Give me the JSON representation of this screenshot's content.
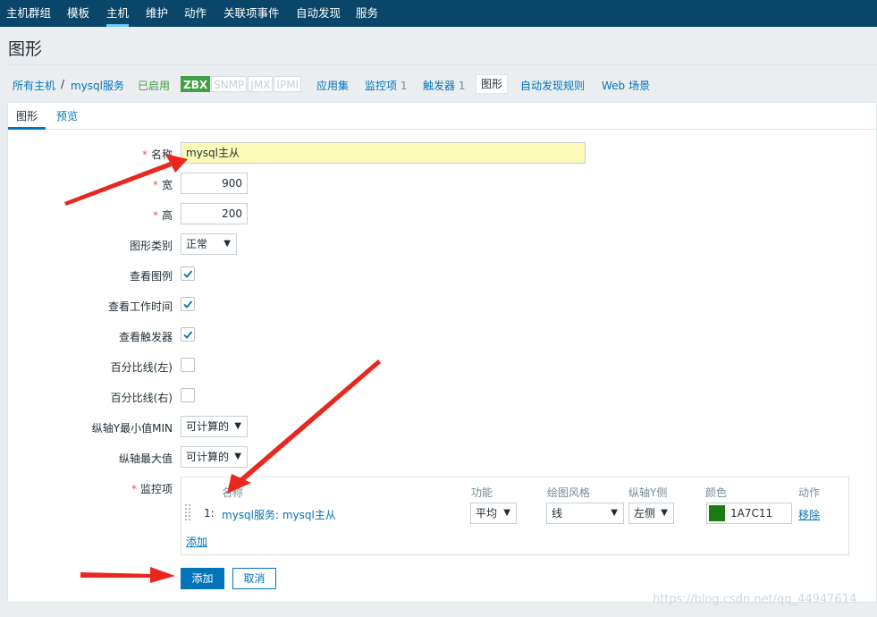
{
  "topnav": {
    "items": [
      "主机群组",
      "模板",
      "主机",
      "维护",
      "动作",
      "关联项事件",
      "自动发现",
      "服务"
    ],
    "active": "主机"
  },
  "page": {
    "title": "图形"
  },
  "hostnav": {
    "all_hosts": "所有主机",
    "separator": "/",
    "host": "mysql服务",
    "status": "已启用",
    "badges": [
      "ZBX",
      "SNMP",
      "JMX",
      "IPMI"
    ],
    "applications": "应用集",
    "items_label": "监控项",
    "items_count": "1",
    "triggers_label": "触发器",
    "triggers_count": "1",
    "graphs": "图形",
    "discovery": "自动发现规则",
    "web": "Web 场景"
  },
  "tabs": {
    "graph": "图形",
    "preview": "预览"
  },
  "form": {
    "name_label": "名称",
    "name_value": "mysql主从",
    "width_label": "宽",
    "width_value": "900",
    "height_label": "高",
    "height_value": "200",
    "graph_type_label": "图形类别",
    "graph_type_value": "正常",
    "show_legend_label": "查看图例",
    "show_working_time_label": "查看工作时间",
    "show_triggers_label": "查看触发器",
    "percentile_left_label": "百分比线(左)",
    "percentile_right_label": "百分比线(右)",
    "y_min_label": "纵轴Y最小值MIN",
    "y_min_value": "可计算的",
    "y_max_label": "纵轴最大值",
    "y_max_value": "可计算的",
    "items_label": "监控项"
  },
  "items_table": {
    "headers": {
      "name": "名称",
      "function": "功能",
      "style": "绘图风格",
      "y_side": "纵轴Y侧",
      "color": "颜色",
      "action": "动作"
    },
    "rows": [
      {
        "index": "1:",
        "name": "mysql服务: mysql主从",
        "function": "平均",
        "style": "线",
        "y_side": "左侧",
        "color": "1A7C11",
        "action": "移除"
      }
    ],
    "add_link": "添加"
  },
  "buttons": {
    "add": "添加",
    "cancel": "取消"
  },
  "colors": {
    "nav_bg": "#0a466a",
    "link": "#0275b8",
    "series": "#1A7C11",
    "annotation_arrow": "#e8281f"
  },
  "watermark": "https://blog.csdn.net/qq_44947614"
}
